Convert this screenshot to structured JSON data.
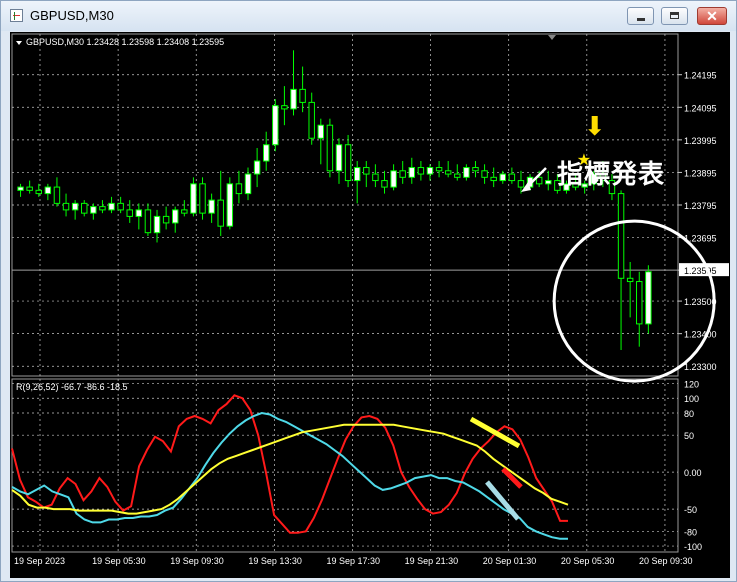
{
  "window": {
    "title": "GBPUSD,M30",
    "close_glyph": "✕"
  },
  "colors": {
    "bg": "#000000",
    "grid": "#c8c8c8",
    "bull": "#00ff00",
    "bear_fill": "#000000",
    "candle_body_bull": "#ffffff",
    "line_white": "#ffffff",
    "macd_red": "#ff1a1a",
    "macd_cyan": "#4fd9e8",
    "macd_yellow": "#ffff33",
    "arrow": "#ffdd00",
    "star": "#ffe600",
    "circle": "#ffffff"
  },
  "chart_data": {
    "type": "candlestick",
    "symbol_header": "GBPUSD,M30  1.23428  1.23598  1.23408  1.23595",
    "price_axis": {
      "ticks": [
        "1.24195",
        "1.24095",
        "1.23995",
        "1.23895",
        "1.23795",
        "1.23695",
        "1.23595",
        "1.23500",
        "1.23400",
        "1.23300"
      ],
      "values": [
        1.24195,
        1.24095,
        1.23995,
        1.23895,
        1.23795,
        1.23695,
        1.23595,
        1.235,
        1.234,
        1.233
      ],
      "current": "1.23595",
      "ylim": [
        1.2327,
        1.2432
      ]
    },
    "time_axis": [
      "19 Sep 2023",
      "19 Sep 05:30",
      "19 Sep 09:30",
      "19 Sep 13:30",
      "19 Sep 17:30",
      "19 Sep 21:30",
      "20 Sep 01:30",
      "20 Sep 05:30",
      "20 Sep 09:30"
    ],
    "candles": [
      [
        1.2384,
        1.2386,
        1.2382,
        1.2385
      ],
      [
        1.2385,
        1.2387,
        1.2383,
        1.2384
      ],
      [
        1.2384,
        1.2386,
        1.2382,
        1.2383
      ],
      [
        1.2383,
        1.2386,
        1.2381,
        1.2385
      ],
      [
        1.2385,
        1.2388,
        1.2379,
        1.238
      ],
      [
        1.238,
        1.2383,
        1.2376,
        1.2378
      ],
      [
        1.2378,
        1.2381,
        1.2375,
        1.238
      ],
      [
        1.238,
        1.2381,
        1.2376,
        1.2377
      ],
      [
        1.2377,
        1.238,
        1.2375,
        1.2379
      ],
      [
        1.2379,
        1.2381,
        1.2377,
        1.2378
      ],
      [
        1.2378,
        1.2382,
        1.2377,
        1.238
      ],
      [
        1.238,
        1.2382,
        1.2377,
        1.2378
      ],
      [
        1.2378,
        1.2381,
        1.2374,
        1.2376
      ],
      [
        1.2376,
        1.238,
        1.2372,
        1.2378
      ],
      [
        1.2378,
        1.238,
        1.237,
        1.2371
      ],
      [
        1.2371,
        1.2378,
        1.2368,
        1.2376
      ],
      [
        1.2376,
        1.2379,
        1.2372,
        1.2374
      ],
      [
        1.2374,
        1.2379,
        1.2371,
        1.2378
      ],
      [
        1.2378,
        1.2381,
        1.2376,
        1.2377
      ],
      [
        1.2377,
        1.2388,
        1.2376,
        1.2386
      ],
      [
        1.2386,
        1.2388,
        1.2375,
        1.2377
      ],
      [
        1.2377,
        1.2383,
        1.2374,
        1.2381
      ],
      [
        1.2381,
        1.239,
        1.237,
        1.2373
      ],
      [
        1.2373,
        1.2388,
        1.2372,
        1.2386
      ],
      [
        1.2386,
        1.239,
        1.238,
        1.2383
      ],
      [
        1.2383,
        1.2391,
        1.2381,
        1.2389
      ],
      [
        1.2389,
        1.2397,
        1.2385,
        1.2393
      ],
      [
        1.2393,
        1.2402,
        1.239,
        1.2398
      ],
      [
        1.2398,
        1.2412,
        1.2396,
        1.241
      ],
      [
        1.241,
        1.2416,
        1.2404,
        1.2409
      ],
      [
        1.2409,
        1.2427,
        1.2407,
        1.2415
      ],
      [
        1.2415,
        1.2422,
        1.2408,
        1.2411
      ],
      [
        1.2411,
        1.2414,
        1.2398,
        1.24
      ],
      [
        1.24,
        1.2406,
        1.2392,
        1.2404
      ],
      [
        1.2404,
        1.2406,
        1.2388,
        1.239
      ],
      [
        1.239,
        1.24,
        1.2386,
        1.2398
      ],
      [
        1.2398,
        1.2401,
        1.2385,
        1.2387
      ],
      [
        1.2387,
        1.2393,
        1.238,
        1.2391
      ],
      [
        1.2391,
        1.2393,
        1.2385,
        1.2389
      ],
      [
        1.2389,
        1.2392,
        1.2385,
        1.2387
      ],
      [
        1.2387,
        1.239,
        1.2383,
        1.2385
      ],
      [
        1.2385,
        1.2392,
        1.2384,
        1.239
      ],
      [
        1.239,
        1.2393,
        1.2386,
        1.2388
      ],
      [
        1.2388,
        1.2394,
        1.2386,
        1.2391
      ],
      [
        1.2391,
        1.2393,
        1.2387,
        1.2389
      ],
      [
        1.2389,
        1.2392,
        1.2387,
        1.2391
      ],
      [
        1.2391,
        1.2393,
        1.2388,
        1.239
      ],
      [
        1.239,
        1.2393,
        1.2388,
        1.2389
      ],
      [
        1.2389,
        1.2392,
        1.2387,
        1.2388
      ],
      [
        1.2388,
        1.2392,
        1.2387,
        1.2391
      ],
      [
        1.2391,
        1.2393,
        1.2388,
        1.239
      ],
      [
        1.239,
        1.2392,
        1.2386,
        1.2388
      ],
      [
        1.2388,
        1.2391,
        1.2385,
        1.2387
      ],
      [
        1.2387,
        1.239,
        1.2386,
        1.2389
      ],
      [
        1.2389,
        1.2391,
        1.2386,
        1.2387
      ],
      [
        1.2387,
        1.239,
        1.2383,
        1.2385
      ],
      [
        1.2385,
        1.2389,
        1.2384,
        1.2388
      ],
      [
        1.2388,
        1.239,
        1.2385,
        1.2386
      ],
      [
        1.2386,
        1.239,
        1.2384,
        1.2387
      ],
      [
        1.2387,
        1.2389,
        1.2383,
        1.2384
      ],
      [
        1.2384,
        1.2387,
        1.2383,
        1.2386
      ],
      [
        1.2386,
        1.2389,
        1.2384,
        1.2385
      ],
      [
        1.2385,
        1.2387,
        1.2383,
        1.2386
      ],
      [
        1.2386,
        1.239,
        1.2384,
        1.2389
      ],
      [
        1.2389,
        1.2393,
        1.2385,
        1.2387
      ],
      [
        1.2387,
        1.2389,
        1.2381,
        1.2383
      ],
      [
        1.2383,
        1.2384,
        1.2335,
        1.2357
      ],
      [
        1.2357,
        1.2362,
        1.2345,
        1.2356
      ],
      [
        1.2356,
        1.2359,
        1.2336,
        1.2343
      ],
      [
        1.2343,
        1.2361,
        1.234,
        1.2359
      ]
    ],
    "indicator": {
      "label": "R(9,26,52) -66.7 -86.6 -18.5",
      "y_ticks": [
        "120",
        "100",
        "80",
        "50",
        "0.00",
        "-50",
        "-80",
        "-100"
      ],
      "y_values": [
        120,
        100,
        80,
        50,
        0,
        -50,
        -80,
        -100
      ],
      "ylim": [
        -108,
        126
      ],
      "series": [
        {
          "color": "#ff1a1a",
          "values": [
            32,
            -10,
            -34,
            -40,
            -48,
            -44,
            -22,
            -8,
            -16,
            -38,
            -26,
            -8,
            -20,
            -40,
            -52,
            -46,
            8,
            30,
            48,
            42,
            28,
            62,
            72,
            76,
            72,
            66,
            84,
            92,
            104,
            100,
            84,
            50,
            -2,
            -58,
            -70,
            -82,
            -82,
            -80,
            -62,
            -38,
            -10,
            18,
            44,
            62,
            74,
            76,
            72,
            60,
            36,
            0,
            -20,
            -36,
            -50,
            -56,
            -54,
            -44,
            -28,
            -2,
            18,
            32,
            42,
            54,
            62,
            58,
            44,
            20,
            -8,
            -24,
            -40,
            -66,
            -66
          ]
        },
        {
          "color": "#4fd9e8",
          "values": [
            -20,
            -26,
            -30,
            -24,
            -18,
            -26,
            -30,
            -34,
            -56,
            -64,
            -68,
            -68,
            -64,
            -64,
            -62,
            -62,
            -60,
            -60,
            -58,
            -52,
            -48,
            -36,
            -22,
            -8,
            10,
            26,
            40,
            52,
            62,
            70,
            76,
            80,
            78,
            72,
            68,
            62,
            56,
            50,
            44,
            38,
            30,
            22,
            12,
            2,
            -8,
            -18,
            -24,
            -22,
            -18,
            -14,
            -8,
            -6,
            -4,
            -8,
            -8,
            -12,
            -14,
            -20,
            -26,
            -34,
            -42,
            -50,
            -56,
            -62,
            -74,
            -80,
            -84,
            -88,
            -90,
            -90
          ]
        },
        {
          "color": "#ffff33",
          "values": [
            -24,
            -32,
            -44,
            -48,
            -48,
            -50,
            -50,
            -50,
            -52,
            -52,
            -52,
            -52,
            -52,
            -54,
            -56,
            -56,
            -54,
            -52,
            -50,
            -44,
            -36,
            -26,
            -16,
            -6,
            4,
            12,
            18,
            22,
            26,
            30,
            34,
            38,
            42,
            46,
            50,
            54,
            56,
            58,
            60,
            62,
            64,
            64,
            64,
            64,
            64,
            64,
            64,
            62,
            60,
            58,
            56,
            54,
            52,
            48,
            44,
            40,
            36,
            28,
            18,
            10,
            2,
            -6,
            -14,
            -22,
            -28,
            -36,
            -40,
            -44
          ]
        }
      ]
    },
    "annotation": {
      "caption": "指標発表",
      "arrow_glyph": "⬇",
      "star_glyph": "★"
    }
  }
}
